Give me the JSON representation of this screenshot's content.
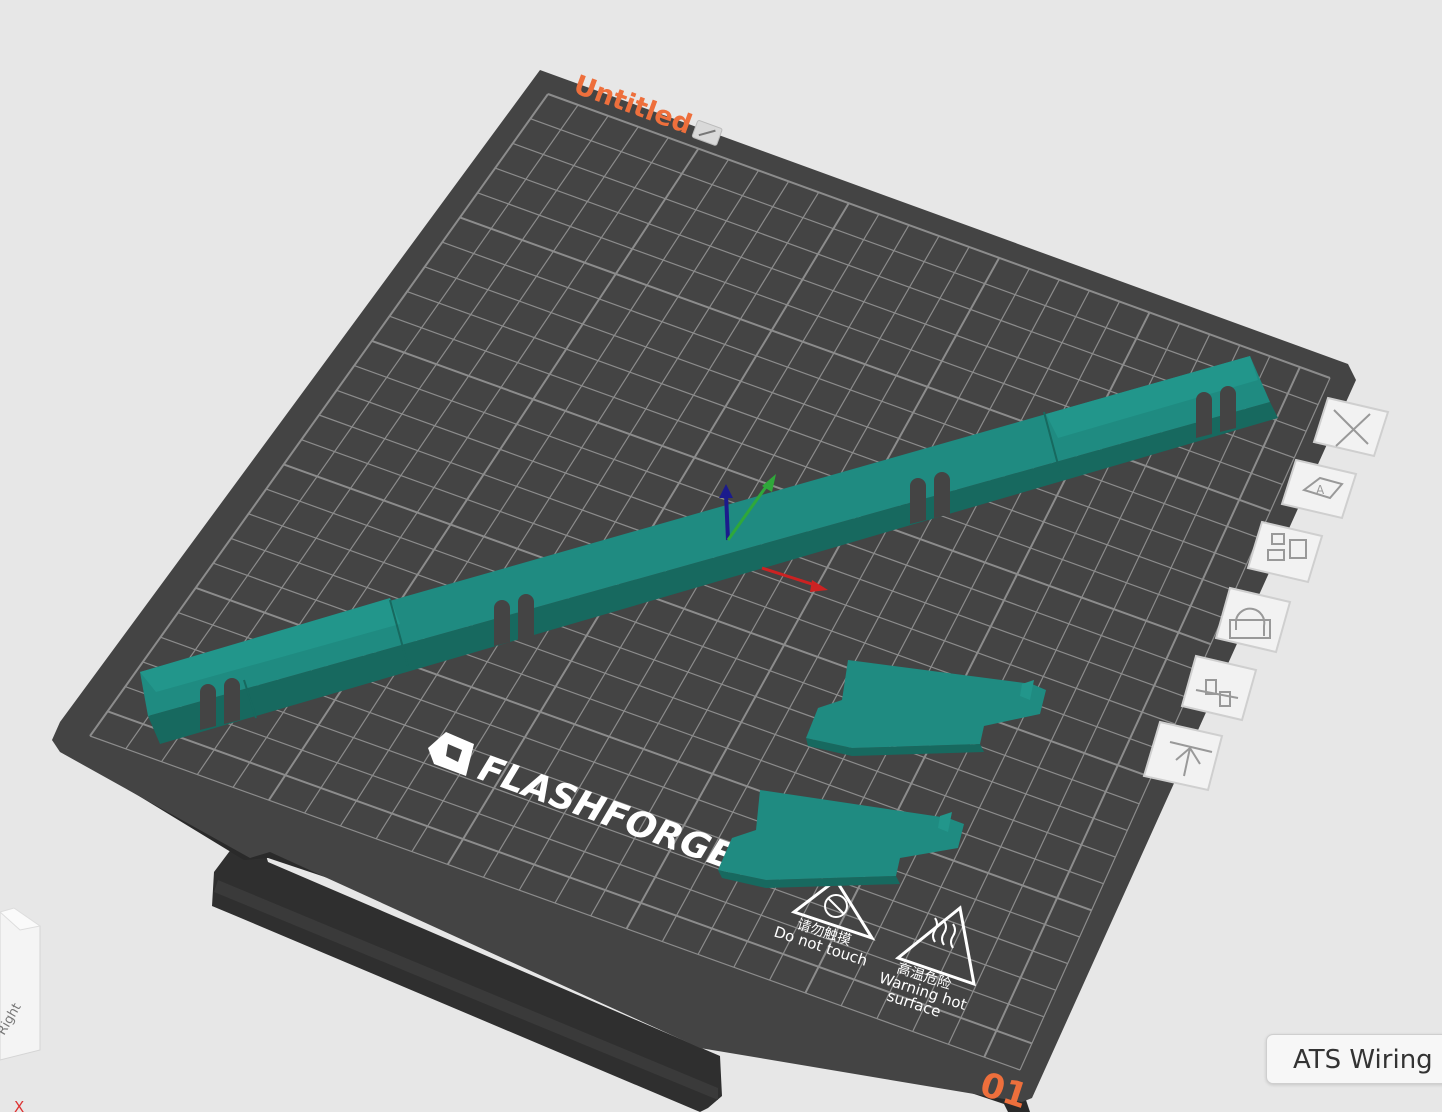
{
  "plate": {
    "name": "Untitled",
    "number": "01",
    "brand": "FLASHFORGE",
    "warnings": {
      "no_touch_cn": "请勿触摸",
      "no_touch_en": "Do not touch",
      "hot_cn": "高温危险",
      "hot_en_line1": "Warning hot",
      "hot_en_line2": "surface"
    }
  },
  "toolbar_icons": [
    "close-icon",
    "auto-orient-icon",
    "arrange-icon",
    "lock-icon",
    "plate-settings-icon",
    "move-to-top-icon"
  ],
  "view_cube": {
    "face_label": "Right"
  },
  "axis_indicator": {
    "x_label": "X"
  },
  "tooltip": {
    "text": "ATS Wiring"
  },
  "colors": {
    "plate": "#444444",
    "grid": "#8c8c8c",
    "model": "#1f8b81",
    "accent": "#ee6f3c",
    "background": "#e7e7e7"
  }
}
